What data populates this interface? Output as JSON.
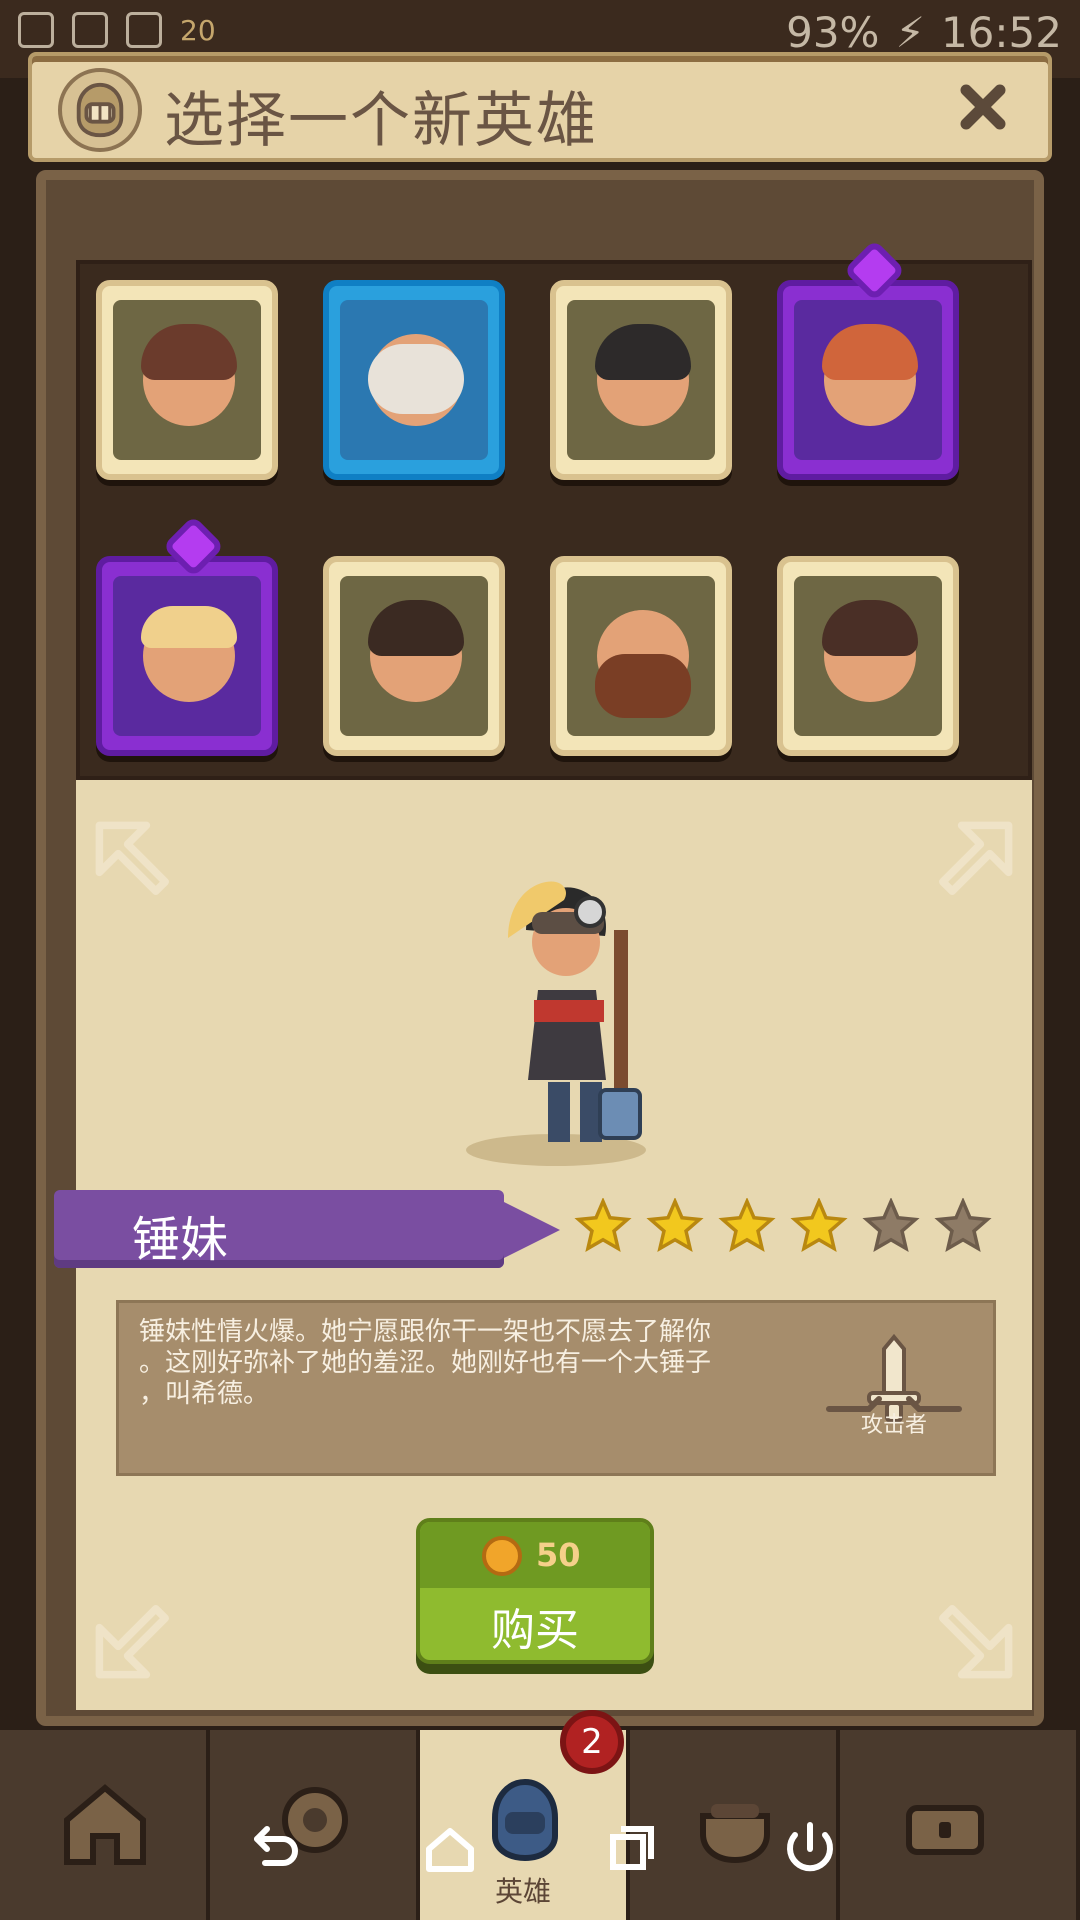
{
  "status_bar": {
    "level_badge": "20",
    "battery_percent": "93%",
    "time": "16:52"
  },
  "dialog": {
    "title": "选择一个新英雄",
    "icons": {
      "title_icon": "helmet-icon",
      "close_icon": "close-icon"
    }
  },
  "selected_hero": {
    "name": "锤妹",
    "stars_total": 6,
    "stars_filled": 4,
    "description": "锤妹性情火爆。她宁愿跟你干一架也不愿去了解你\n。这刚好弥补了她的羞涩。她刚好也有一个大锤子\n，叫希德。",
    "role_label": "攻击者"
  },
  "purchase": {
    "price": "50",
    "label": "购买"
  },
  "bottom_tabs": [
    {
      "name": "home-tab",
      "label": ""
    },
    {
      "name": "settings-tab",
      "label": ""
    },
    {
      "name": "heroes-tab",
      "label": "英雄",
      "badge": "2"
    },
    {
      "name": "potion-tab",
      "label": ""
    },
    {
      "name": "chest-tab",
      "label": ""
    }
  ],
  "colors": {
    "title_text": "#6a5544",
    "purple": "#7a4ea1",
    "buy_green": "#8fbb2f"
  }
}
